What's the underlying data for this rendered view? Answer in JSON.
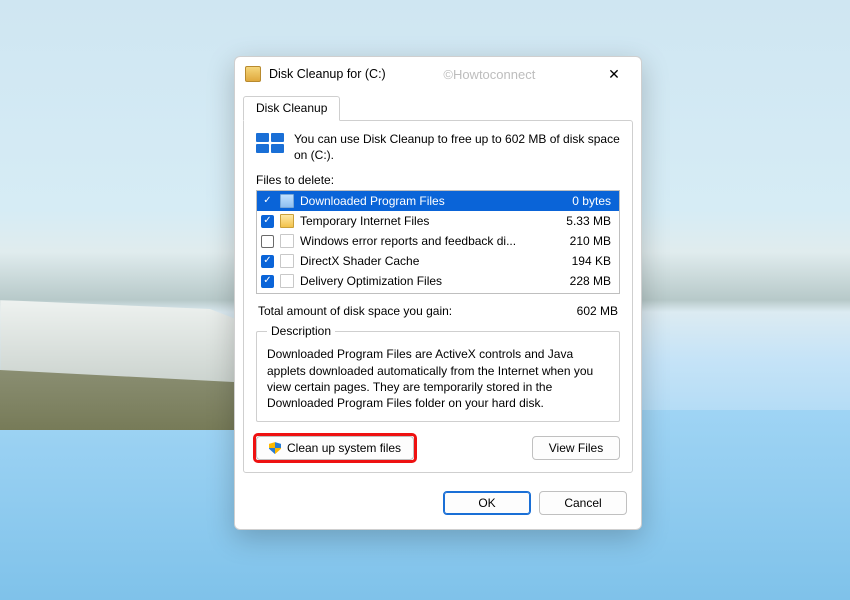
{
  "window": {
    "title": "Disk Cleanup for  (C:)",
    "watermark": "©Howtoconnect"
  },
  "tab": {
    "label": "Disk Cleanup"
  },
  "intro": "You can use Disk Cleanup to free up to 602 MB of disk space on  (C:).",
  "files_label": "Files to delete:",
  "files": [
    {
      "name": "Downloaded Program Files",
      "size": "0 bytes",
      "checked": true,
      "icon": "app",
      "selected": true
    },
    {
      "name": "Temporary Internet Files",
      "size": "5.33 MB",
      "checked": true,
      "icon": "lock",
      "selected": false
    },
    {
      "name": "Windows error reports and feedback di...",
      "size": "210 MB",
      "checked": false,
      "icon": "file",
      "selected": false
    },
    {
      "name": "DirectX Shader Cache",
      "size": "194 KB",
      "checked": true,
      "icon": "file",
      "selected": false
    },
    {
      "name": "Delivery Optimization Files",
      "size": "228 MB",
      "checked": true,
      "icon": "file",
      "selected": false
    }
  ],
  "total": {
    "label": "Total amount of disk space you gain:",
    "value": "602 MB"
  },
  "description": {
    "legend": "Description",
    "text": "Downloaded Program Files are ActiveX controls and Java applets downloaded automatically from the Internet when you view certain pages. They are temporarily stored in the Downloaded Program Files folder on your hard disk."
  },
  "buttons": {
    "cleanup_system": "Clean up system files",
    "view_files": "View Files",
    "ok": "OK",
    "cancel": "Cancel"
  }
}
